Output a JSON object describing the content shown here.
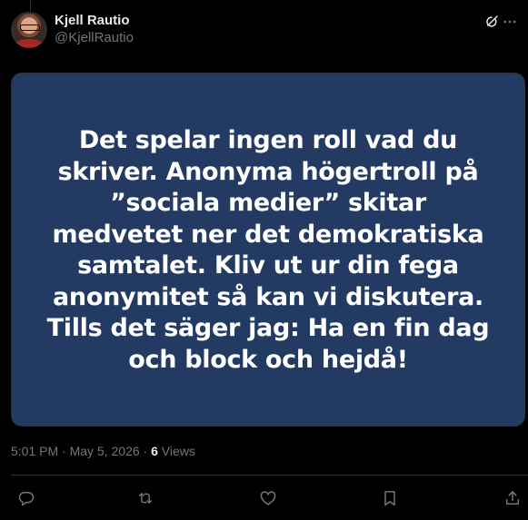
{
  "author": {
    "display_name": "Kjell Rautio",
    "handle": "@KjellRautio"
  },
  "post": {
    "image_text": "Det spelar ingen roll vad du\nskriver. Anonyma högertroll på\n”sociala medier” skitar\nmedvetet ner det demokratiska\nsamtalet. Kliv ut ur din fega\nanonymitet så kan vi diskutera.\nTills det säger jag: Ha en fin dag\noch block och hejdå!",
    "image_background": "#233a63"
  },
  "meta": {
    "time": "5:01 PM",
    "separator": " · ",
    "date": "May 5, 2026",
    "views_count": "6",
    "views_label": " Views"
  },
  "icons": {
    "grok": "grok-icon",
    "more": "more-icon",
    "reply": "reply-icon",
    "repost": "repost-icon",
    "like": "like-icon",
    "bookmark": "bookmark-icon",
    "share": "share-icon"
  },
  "colors": {
    "background": "#000000",
    "text": "#e7e9ea",
    "muted": "#71767b",
    "divider": "#2f3336"
  }
}
